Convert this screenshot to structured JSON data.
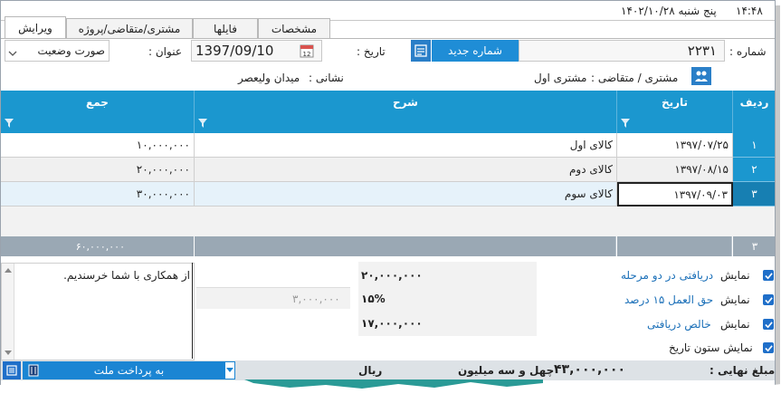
{
  "topbar": {
    "time": "۱۴:۴۸",
    "date": "پنج شنبه  ۱۴۰۲/۱۰/۲۸"
  },
  "tabs": [
    {
      "label": "ویرایش",
      "active": true
    },
    {
      "label": "مشتری/متقاضی/پروژه",
      "active": false
    },
    {
      "label": "فایلها",
      "active": false
    },
    {
      "label": "مشخصات",
      "active": false
    }
  ],
  "form": {
    "number_label": "شماره :",
    "number_value": "۲۲۳۱",
    "new_number_button": "شماره جدید",
    "date_label": "تاریخ :",
    "date_value": "1397/09/10",
    "title_label": "عنوان :",
    "title_value": "صورت وضعیت",
    "customer_label": "مشتری / متقاضی :",
    "customer_value": "مشتری اول",
    "address_label": "نشانی :",
    "address_value": "میدان ولیعصر"
  },
  "grid": {
    "headers": {
      "row": "ردیف",
      "date": "تاریخ",
      "desc": "شرح",
      "total": "جمع"
    },
    "rows": [
      {
        "num": "۱",
        "date": "۱۳۹۷/۰۷/۲۵",
        "desc": "کالای اول",
        "total": "۱۰,۰۰۰,۰۰۰"
      },
      {
        "num": "۲",
        "date": "۱۳۹۷/۰۸/۱۵",
        "desc": "کالای دوم",
        "total": "۲۰,۰۰۰,۰۰۰"
      },
      {
        "num": "۳",
        "date": "۱۳۹۷/۰۹/۰۳",
        "desc": "کالای سوم",
        "total": "۳۰,۰۰۰,۰۰۰"
      }
    ],
    "footer": {
      "count": "۳",
      "sum": "۶۰,۰۰۰,۰۰۰"
    }
  },
  "summary": {
    "items": [
      {
        "show": "نمایش",
        "label": "دریافتی در دو مرحله",
        "value": "۲۰,۰۰۰,۰۰۰"
      },
      {
        "show": "نمایش",
        "label": "حق العمل ۱۵ درصد",
        "value": "۱۵%",
        "extra": "۳,۰۰۰,۰۰۰"
      },
      {
        "show": "نمایش",
        "label": "خالص دریافتی",
        "value": "۱۷,۰۰۰,۰۰۰"
      }
    ],
    "date_column": "نمایش ستون تاریخ",
    "note": "از همکاری با شما خرسندیم."
  },
  "footer": {
    "final_label": "مبلغ نهایی :",
    "final_value": "۴۳,۰۰۰,۰۰۰",
    "words": "چهل و سه میلیون",
    "currency": "ریال",
    "bank_select": "به پرداخت ملت"
  },
  "colors": {
    "accent": "#1b97cf",
    "button": "#1f8dd6",
    "check": "#1f6fc9"
  }
}
